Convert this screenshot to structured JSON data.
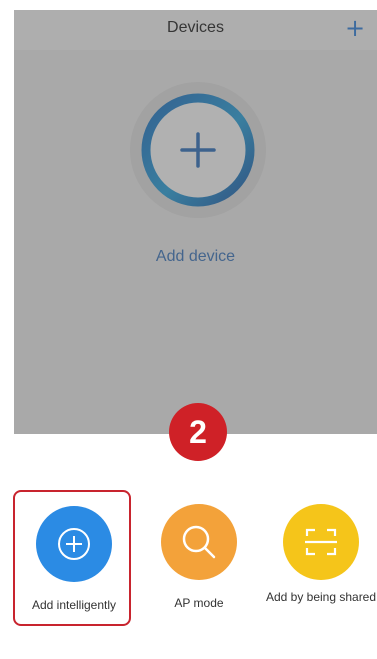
{
  "header": {
    "title": "Devices",
    "add_icon": "plus-icon",
    "add_symbol": "+"
  },
  "main": {
    "add_device_label": "Add device",
    "add_ring_icon": "plus-ring-icon"
  },
  "step": {
    "number": "2",
    "color": "#cf2127"
  },
  "options": [
    {
      "label": "Add intelligently",
      "icon": "plus-circle-icon",
      "color": "#2b8be4",
      "highlighted": true
    },
    {
      "label": "AP mode",
      "icon": "search-icon",
      "color": "#f3a23a",
      "highlighted": false
    },
    {
      "label": "Add by being shared",
      "icon": "scan-icon",
      "color": "#f5c51a",
      "highlighted": false
    }
  ],
  "colors": {
    "accent": "#2f7fd8",
    "highlight_border": "#c8242e"
  }
}
